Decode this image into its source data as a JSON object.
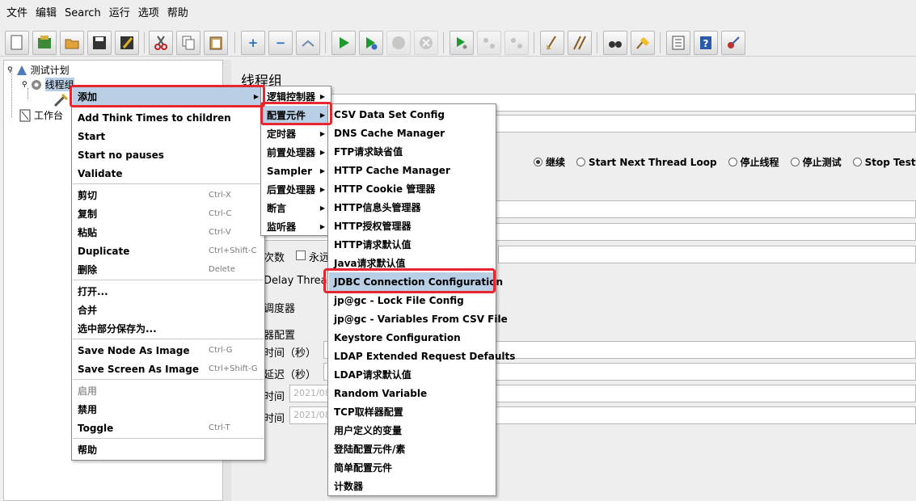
{
  "menubar": [
    "文件",
    "编辑",
    "Search",
    "运行",
    "选项",
    "帮助"
  ],
  "toolbar_icons": [
    "new-icon",
    "templates-icon",
    "open-icon",
    "save-icon",
    "save-as-icon",
    "cut-icon",
    "copy-icon",
    "paste-icon",
    "expand-icon",
    "collapse-icon",
    "toggle-icon",
    "start-icon",
    "start-no-pause-icon",
    "stop-icon",
    "shutdown-icon",
    "remote-start-icon",
    "remote-stop-icon",
    "remote-shutdown-icon",
    "clear-icon",
    "clear-all-icon",
    "search-icon",
    "reset-search-icon",
    "function-helper-icon",
    "help-icon",
    "log-viewer-icon"
  ],
  "tree": {
    "test_plan": "测试计划",
    "thread_group": "线程组",
    "workbench": "工作台"
  },
  "right_panel": {
    "title": "线程组",
    "radio_continue": "继续",
    "radio_next_loop": "Start Next Thread Loop",
    "radio_stop_thread": "停止线程",
    "radio_stop_test": "停止测试",
    "radio_stop_test_now": "Stop Test Nov",
    "loop_label": "次数",
    "forever_label": "永远",
    "delay_label": "Delay Thread",
    "scheduler_label": "调度器",
    "scheduler_config": "器配置",
    "duration_label": "时间（秒）",
    "startup_delay_label": "延迟（秒）",
    "start_time_label": "时间",
    "end_time_label": "时间",
    "start_time_value": "2021/08",
    "end_time_value": "2021/08"
  },
  "context_menu": {
    "add": "添加",
    "add_think_times": "Add Think Times to children",
    "start": "Start",
    "start_no_pauses": "Start no pauses",
    "validate": "Validate",
    "cut": "剪切",
    "cut_sc": "Ctrl-X",
    "copy": "复制",
    "copy_sc": "Ctrl-C",
    "paste": "粘贴",
    "paste_sc": "Ctrl-V",
    "duplicate": "Duplicate",
    "duplicate_sc": "Ctrl+Shift-C",
    "delete": "删除",
    "delete_sc": "Delete",
    "open": "打开...",
    "merge": "合并",
    "save_selection": "选中部分保存为...",
    "save_node_image": "Save Node As Image",
    "save_node_image_sc": "Ctrl-G",
    "save_screen_image": "Save Screen As Image",
    "save_screen_image_sc": "Ctrl+Shift-G",
    "enable": "启用",
    "disable": "禁用",
    "toggle": "Toggle",
    "toggle_sc": "Ctrl-T",
    "help": "帮助"
  },
  "add_submenu": [
    "逻辑控制器",
    "配置元件",
    "定时器",
    "前置处理器",
    "Sampler",
    "后置处理器",
    "断言",
    "监听器"
  ],
  "config_submenu": [
    "CSV Data Set Config",
    "DNS Cache Manager",
    "FTP请求缺省值",
    "HTTP Cache Manager",
    "HTTP Cookie 管理器",
    "HTTP信息头管理器",
    "HTTP授权管理器",
    "HTTP请求默认值",
    "Java请求默认值",
    "JDBC Connection Configuration",
    "jp@gc - Lock File Config",
    "jp@gc - Variables From CSV File",
    "Keystore Configuration",
    "LDAP Extended Request Defaults",
    "LDAP请求默认值",
    "Random Variable",
    "TCP取样器配置",
    "用户定义的变量",
    "登陆配置元件/素",
    "简单配置元件",
    "计数器"
  ],
  "colors": {
    "highlight": "#b8cfe5",
    "annotation_red": "#e8262f"
  }
}
